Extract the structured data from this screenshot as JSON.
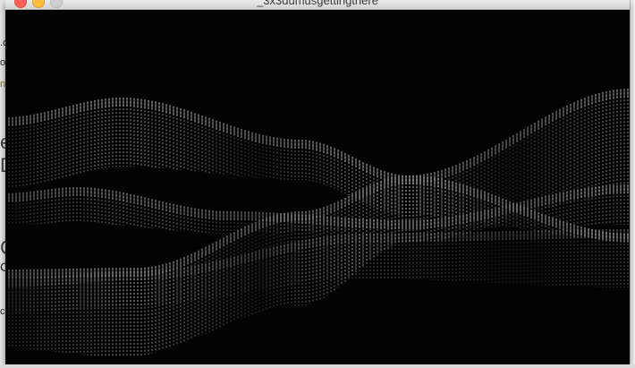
{
  "window": {
    "title": "_3x3dumusgettingthere"
  },
  "background": {
    "fragments": [
      ".c",
      "od",
      "na",
      "e",
      "D",
      "G",
      "C",
      "ch"
    ]
  },
  "icons": {
    "close": "close-icon",
    "minimize": "minimize-icon",
    "maximize": "maximize-icon"
  },
  "colors": {
    "canvas_background": "#040404",
    "stroke": "#ffffff",
    "title_text": "#3a3a3a"
  }
}
